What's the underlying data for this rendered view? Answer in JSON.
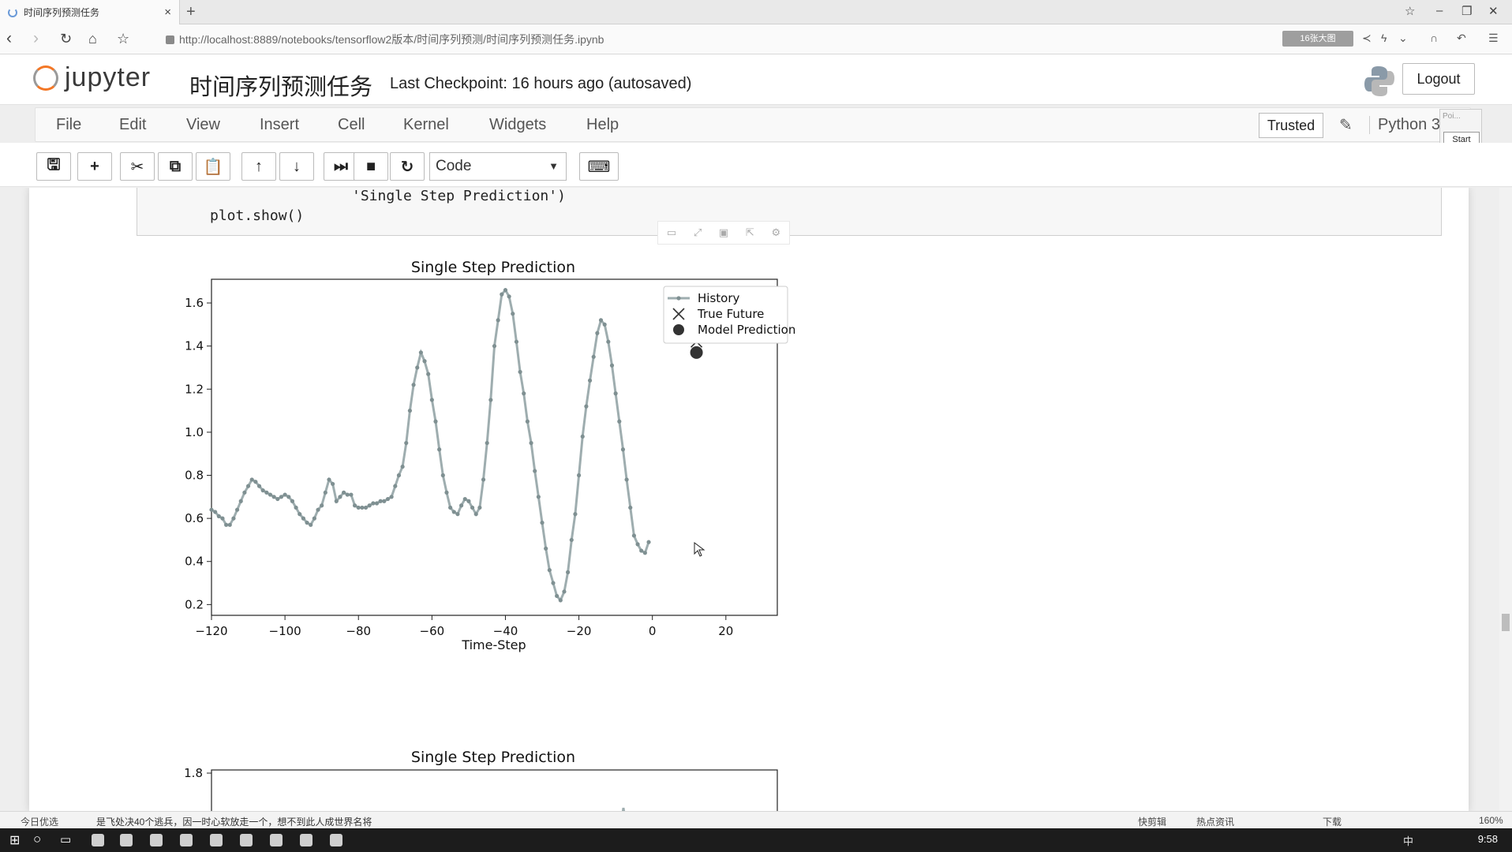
{
  "browser": {
    "tab_title": "时间序列预测任务",
    "url": "http://localhost:8889/notebooks/tensorflow2版本/时间序列预测/时间序列预测任务.ipynb",
    "ext_badge": "16张大图"
  },
  "jupyter": {
    "logo_text": "jupyter",
    "notebook_name": "时间序列预测任务",
    "checkpoint": "Last Checkpoint: 16 hours ago (autosaved)",
    "logout": "Logout",
    "trusted": "Trusted",
    "kernel": "Python 3",
    "popup_label": "Poi...",
    "popup_start": "Start"
  },
  "menu": [
    "File",
    "Edit",
    "View",
    "Insert",
    "Cell",
    "Kernel",
    "Widgets",
    "Help"
  ],
  "toolbar": {
    "cell_type": "Code",
    "buttons": [
      "save-icon",
      "plus-icon",
      "scissors-icon",
      "copy-icon",
      "paste-icon",
      "arrow-up-icon",
      "arrow-down-icon",
      "run-icon",
      "stop-icon",
      "restart-icon",
      "keyboard-icon"
    ]
  },
  "code": {
    "line1": "'Single Step Prediction')",
    "line2": "plot.show()"
  },
  "status": {
    "left": "今日优选",
    "news": "是飞处决40个逃兵，因一时心软放走一个，想不到此人成世界名将",
    "items": [
      "快剪辑",
      "热点资讯",
      "下载"
    ],
    "zoom": "160%",
    "clock": "9:58"
  },
  "chart_data": [
    {
      "type": "line",
      "title": "Single Step Prediction",
      "xlabel": "Time-Step",
      "ylabel": "",
      "xlim": [
        -120,
        34
      ],
      "ylim": [
        0.15,
        1.71
      ],
      "xticks": [
        -120,
        -100,
        -80,
        -60,
        -40,
        -20,
        0,
        20
      ],
      "yticks": [
        0.2,
        0.4,
        0.6,
        0.8,
        1.0,
        1.2,
        1.4,
        1.6
      ],
      "legend": [
        "History",
        "True Future",
        "Model Prediction"
      ],
      "legend_position": "top-right",
      "series": [
        {
          "name": "History",
          "x": [
            -120,
            -119,
            -118,
            -117,
            -116,
            -115,
            -114,
            -113,
            -112,
            -111,
            -110,
            -109,
            -108,
            -107,
            -106,
            -105,
            -104,
            -103,
            -102,
            -101,
            -100,
            -99,
            -98,
            -97,
            -96,
            -95,
            -94,
            -93,
            -92,
            -91,
            -90,
            -89,
            -88,
            -87,
            -86,
            -85,
            -84,
            -83,
            -82,
            -81,
            -80,
            -79,
            -78,
            -77,
            -76,
            -75,
            -74,
            -73,
            -72,
            -71,
            -70,
            -69,
            -68,
            -67,
            -66,
            -65,
            -64,
            -63,
            -62,
            -61,
            -60,
            -59,
            -58,
            -57,
            -56,
            -55,
            -54,
            -53,
            -52,
            -51,
            -50,
            -49,
            -48,
            -47,
            -46,
            -45,
            -44,
            -43,
            -42,
            -41,
            -40,
            -39,
            -38,
            -37,
            -36,
            -35,
            -34,
            -33,
            -32,
            -31,
            -30,
            -29,
            -28,
            -27,
            -26,
            -25,
            -24,
            -23,
            -22,
            -21,
            -20,
            -19,
            -18,
            -17,
            -16,
            -15,
            -14,
            -13,
            -12,
            -11,
            -10,
            -9,
            -8,
            -7,
            -6,
            -5,
            -4,
            -3,
            -2,
            -1
          ],
          "values": [
            0.64,
            0.63,
            0.61,
            0.6,
            0.57,
            0.57,
            0.6,
            0.64,
            0.68,
            0.72,
            0.75,
            0.78,
            0.77,
            0.75,
            0.73,
            0.72,
            0.71,
            0.7,
            0.69,
            0.7,
            0.71,
            0.7,
            0.68,
            0.65,
            0.62,
            0.6,
            0.58,
            0.57,
            0.6,
            0.64,
            0.66,
            0.72,
            0.78,
            0.76,
            0.68,
            0.7,
            0.72,
            0.71,
            0.71,
            0.66,
            0.65,
            0.65,
            0.65,
            0.66,
            0.67,
            0.67,
            0.68,
            0.68,
            0.69,
            0.7,
            0.75,
            0.8,
            0.84,
            0.95,
            1.1,
            1.22,
            1.3,
            1.37,
            1.33,
            1.27,
            1.15,
            1.05,
            0.92,
            0.8,
            0.72,
            0.65,
            0.63,
            0.62,
            0.66,
            0.69,
            0.68,
            0.65,
            0.62,
            0.65,
            0.78,
            0.95,
            1.15,
            1.4,
            1.52,
            1.64,
            1.66,
            1.63,
            1.55,
            1.42,
            1.28,
            1.18,
            1.05,
            0.95,
            0.82,
            0.7,
            0.58,
            0.46,
            0.36,
            0.3,
            0.24,
            0.22,
            0.26,
            0.35,
            0.5,
            0.62,
            0.8,
            0.98,
            1.12,
            1.24,
            1.35,
            1.46,
            1.52,
            1.5,
            1.42,
            1.31,
            1.18,
            1.05,
            0.92,
            0.78,
            0.65,
            0.52,
            0.48,
            0.45,
            0.44,
            0.49
          ]
        },
        {
          "name": "True Future",
          "x": [
            12
          ],
          "values": [
            1.42
          ]
        },
        {
          "name": "Model Prediction",
          "x": [
            12
          ],
          "values": [
            1.37
          ]
        }
      ]
    },
    {
      "type": "line",
      "title": "Single Step Prediction",
      "xlabel": "",
      "ylabel": "",
      "ylim": [
        0.0,
        1.8
      ],
      "yticks": [
        1.8
      ]
    }
  ]
}
